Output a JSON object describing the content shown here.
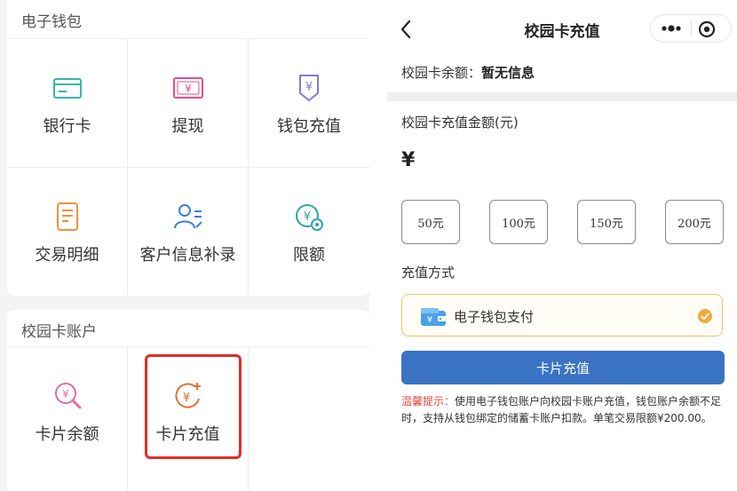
{
  "left": {
    "wallet": {
      "title": "电子钱包",
      "items": [
        {
          "label": "银行卡",
          "icon": "bank-card-icon"
        },
        {
          "label": "提现",
          "icon": "cash-withdraw-icon"
        },
        {
          "label": "钱包充值",
          "icon": "wallet-recharge-icon"
        },
        {
          "label": "交易明细",
          "icon": "transaction-detail-icon"
        },
        {
          "label": "客户信息补录",
          "icon": "customer-info-icon"
        },
        {
          "label": "限额",
          "icon": "limit-icon"
        }
      ]
    },
    "campus": {
      "title": "校园卡账户",
      "items": [
        {
          "label": "卡片余额",
          "icon": "card-balance-icon"
        },
        {
          "label": "卡片充值",
          "icon": "card-recharge-icon"
        }
      ]
    }
  },
  "right": {
    "nav": {
      "title": "校园卡充值"
    },
    "balance": {
      "label": "校园卡余额：",
      "value": "暂无信息"
    },
    "amount": {
      "label": "校园卡充值金额(元)",
      "currency": "¥"
    },
    "presets": [
      "50元",
      "100元",
      "150元",
      "200元"
    ],
    "method": {
      "label": "充值方式",
      "option": "电子钱包支付",
      "selected": true
    },
    "submit_label": "卡片充值",
    "tips": {
      "title": "温馨提示：",
      "body": "使用电子钱包账户向校园卡账户充值，钱包账户余额不足时，支持从钱包绑定的储蓄卡账户扣款。单笔交易限额¥200.00。"
    }
  },
  "colors": {
    "accent_blue": "#3a73c4",
    "highlight_red": "#e02e24",
    "selected_border": "#f0c36a",
    "check_orange": "#f2a93b",
    "tip_red": "#e0483c"
  }
}
